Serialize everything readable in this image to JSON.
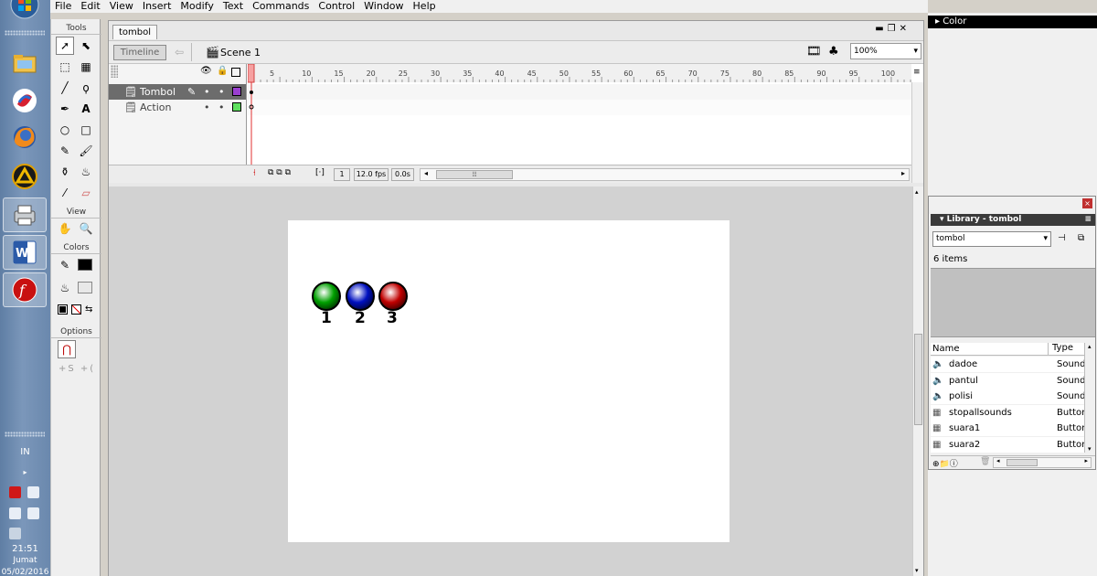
{
  "taskbar": {
    "language": "IN",
    "clock_time": "21:51",
    "clock_day": "Jumat",
    "clock_date": "05/02/2016"
  },
  "menu": [
    "File",
    "Edit",
    "View",
    "Insert",
    "Modify",
    "Text",
    "Commands",
    "Control",
    "Window",
    "Help"
  ],
  "tools": {
    "header": "Tools",
    "view_header": "View",
    "colors_header": "Colors",
    "options_header": "Options"
  },
  "document": {
    "tab": "tombol",
    "timeline_button": "Timeline",
    "scene": "Scene 1",
    "zoom": "100%"
  },
  "timeline": {
    "layers": [
      {
        "name": "Tombol",
        "color": "#9a3fd0"
      },
      {
        "name": "Action",
        "color": "#5ee05e"
      }
    ],
    "ruler": [
      "5",
      "10",
      "15",
      "20",
      "25",
      "30",
      "35",
      "40",
      "45",
      "50",
      "55",
      "60",
      "65",
      "70",
      "75",
      "80",
      "85",
      "90",
      "95",
      "100"
    ],
    "current_frame": "1",
    "frame_rate": "12.0 fps",
    "elapsed": "0.0s"
  },
  "stage": {
    "buttons": [
      {
        "label": "1",
        "color": "#00a000"
      },
      {
        "label": "2",
        "color": "#0010c0"
      },
      {
        "label": "3",
        "color": "#c00000"
      }
    ]
  },
  "panels": {
    "color_title": "Color",
    "library_title": "Library - tombol",
    "library_select": "tombol",
    "library_count": "6 items",
    "col_name": "Name",
    "col_type": "Type",
    "items": [
      {
        "name": "dadoe",
        "type": "Sound",
        "icon": "sound-icon"
      },
      {
        "name": "pantul",
        "type": "Sound",
        "icon": "sound-icon"
      },
      {
        "name": "polisi",
        "type": "Sound",
        "icon": "sound-icon"
      },
      {
        "name": "stopallsounds",
        "type": "Button",
        "icon": "button-symbol-icon"
      },
      {
        "name": "suara1",
        "type": "Button",
        "icon": "button-symbol-icon"
      },
      {
        "name": "suara2",
        "type": "Button",
        "icon": "button-symbol-icon"
      }
    ]
  }
}
